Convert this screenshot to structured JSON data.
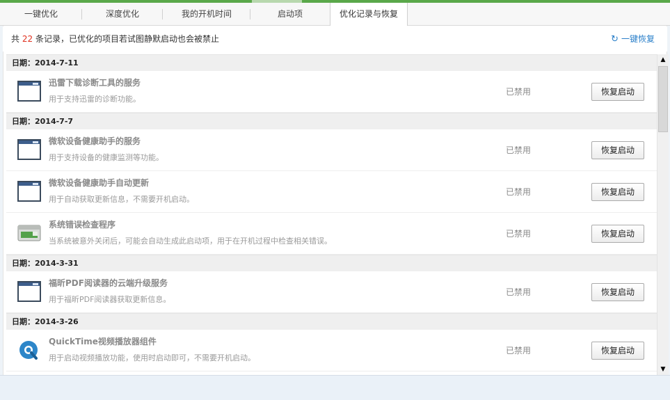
{
  "tabs": [
    {
      "label": "一键优化"
    },
    {
      "label": "深度优化"
    },
    {
      "label": "我的开机时间"
    },
    {
      "label": "启动项"
    },
    {
      "label": "优化记录与恢复"
    }
  ],
  "summary": {
    "prefix": "共",
    "count": "22",
    "suffix": "条记录，已优化的项目若试图静默启动也会被禁止",
    "restore_all": "一键恢复"
  },
  "groups": [
    {
      "date": "日期：2014-7-11",
      "items": [
        {
          "title": "迅雷下载诊断工具的服务",
          "desc": "用于支持迅雷的诊断功能。",
          "status": "已禁用",
          "button": "恢复启动",
          "icon": "window-icon"
        }
      ]
    },
    {
      "date": "日期：2014-7-7",
      "items": [
        {
          "title": "微软设备健康助手的服务",
          "desc": "用于支持设备的健康监测等功能。",
          "status": "已禁用",
          "button": "恢复启动",
          "icon": "window-icon"
        },
        {
          "title": "微软设备健康助手自动更新",
          "desc": "用于自动获取更新信息，不需要开机启动。",
          "status": "已禁用",
          "button": "恢复启动",
          "icon": "window-icon"
        },
        {
          "title": "系统错误检查程序",
          "desc": "当系统被意外关闭后，可能会自动生成此启动项，用于在开机过程中检查相关错误。",
          "status": "已禁用",
          "button": "恢复启动",
          "icon": "system-check-icon"
        }
      ]
    },
    {
      "date": "日期：2014-3-31",
      "items": [
        {
          "title": "福昕PDF阅读器的云端升级服务",
          "desc": "用于福昕PDF阅读器获取更新信息。",
          "status": "已禁用",
          "button": "恢复启动",
          "icon": "window-icon"
        }
      ]
    },
    {
      "date": "日期：2014-3-26",
      "items": [
        {
          "title": "QuickTime视频播放器组件",
          "desc": "用于启动视频播放功能，使用时启动即可，不需要开机启动。",
          "status": "已禁用",
          "button": "恢复启动",
          "icon": "quicktime-icon"
        }
      ]
    }
  ],
  "colors": {
    "accent_green": "#5aa84a",
    "link_blue": "#2a7fc9",
    "count_red": "#e0301e"
  }
}
